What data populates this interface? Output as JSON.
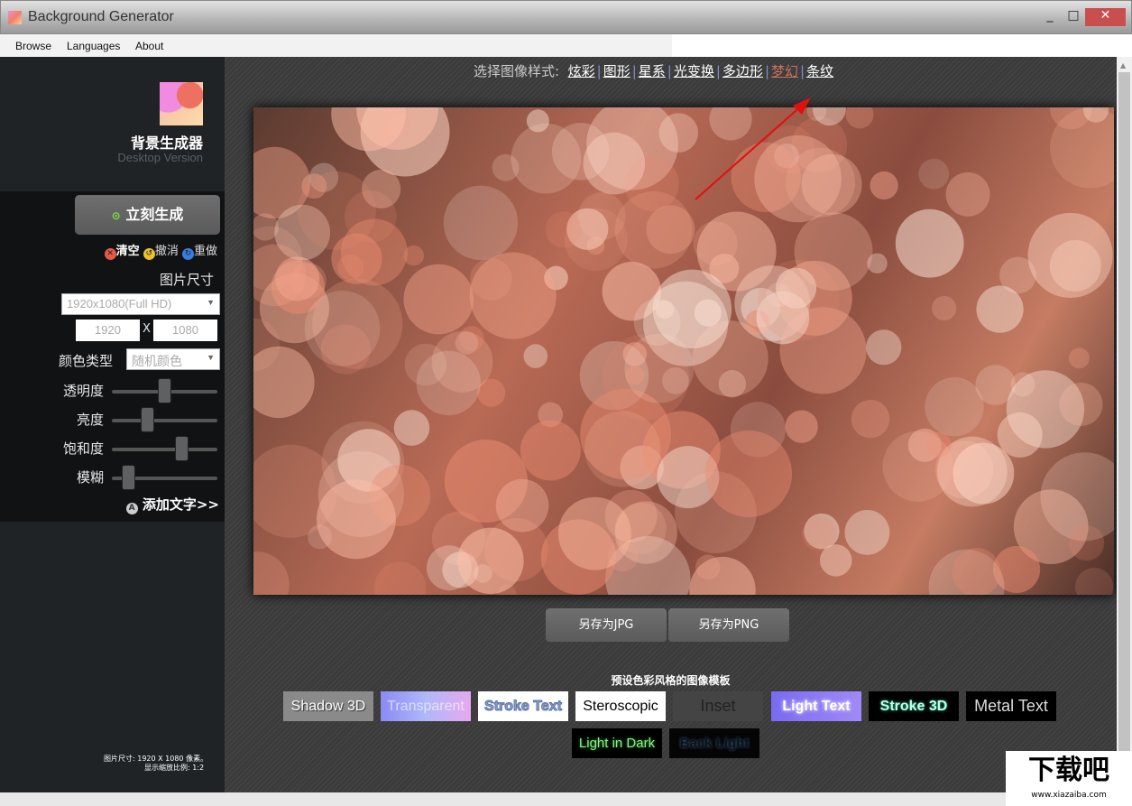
{
  "window": {
    "title": "Background Generator",
    "minimize": "_",
    "maximize": "□",
    "close": "✕"
  },
  "menu": [
    "Browse",
    "Languages",
    "About"
  ],
  "sidebar": {
    "app_name": "背景生成器",
    "app_sub": "Desktop Version",
    "generate_label": "立刻生成",
    "actions": {
      "clear": "清空",
      "undo": "撤消",
      "redo": "重做"
    },
    "size_label": "图片尺寸",
    "size_option": "1920x1080(Full HD)",
    "width": "1920",
    "x": "X",
    "height": "1080",
    "color_type_label": "颜色类型",
    "color_type": "随机颜色",
    "sliders": [
      {
        "label": "透明度",
        "value": 0.5
      },
      {
        "label": "亮度",
        "value": 0.33
      },
      {
        "label": "饱和度",
        "value": 0.67
      },
      {
        "label": "模糊",
        "value": 0.15
      }
    ],
    "add_text": "添加文字>>",
    "info_size": "图片尺寸:  1920 X 1080 像素。",
    "info_scale": "显示缩放比例:  1:2"
  },
  "main": {
    "style_prefix": "选择图像样式:",
    "styles": [
      "炫彩",
      "图形",
      "星系",
      "光变换",
      "多边形",
      "梦幻",
      "条纹"
    ],
    "active_style": "梦幻",
    "save_jpg": "另存为JPG",
    "save_png": "另存为PNG",
    "templates_title": "预设色彩风格的图像模板",
    "templates": [
      "Shadow 3D",
      "Transparent",
      "Stroke Text",
      "Steroscopic",
      "Inset",
      "Light Text",
      "Stroke 3D",
      "Metal Text",
      "Light in Dark",
      "Back Light"
    ]
  },
  "colors": {
    "sidebar": "#202326",
    "panel": "#111213",
    "close": "#c94f4f",
    "active_style": "#c9735e",
    "arrow": "#e01010"
  },
  "watermark": {
    "main": "下载吧",
    "url": "www.xiazaiba.com"
  }
}
